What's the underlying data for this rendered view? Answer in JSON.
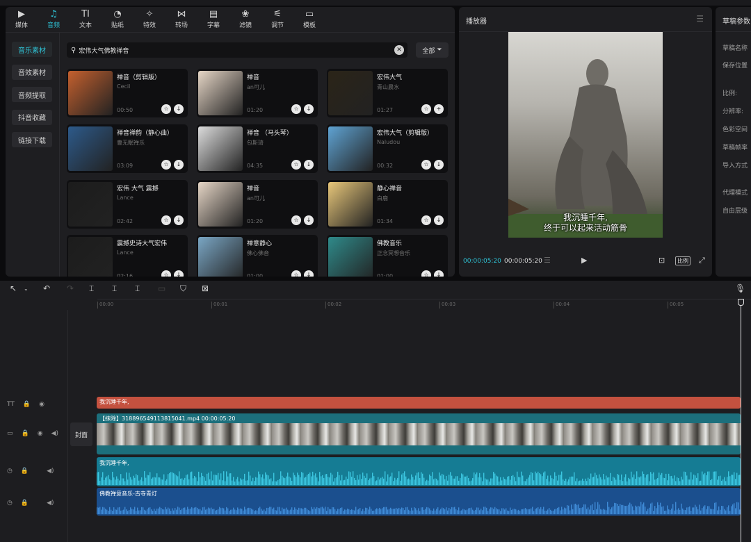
{
  "tabs": [
    {
      "label": "媒体",
      "icon": "media-icon",
      "glyph": "▶"
    },
    {
      "label": "音频",
      "icon": "audio-icon",
      "glyph": "♫",
      "active": true
    },
    {
      "label": "文本",
      "icon": "text-icon",
      "glyph": "TI"
    },
    {
      "label": "贴纸",
      "icon": "sticker-icon",
      "glyph": "◔"
    },
    {
      "label": "特效",
      "icon": "effects-icon",
      "glyph": "✧"
    },
    {
      "label": "转场",
      "icon": "transition-icon",
      "glyph": "⋈"
    },
    {
      "label": "字幕",
      "icon": "caption-icon",
      "glyph": "▤"
    },
    {
      "label": "滤镜",
      "icon": "filter-icon",
      "glyph": "❀"
    },
    {
      "label": "调节",
      "icon": "adjust-icon",
      "glyph": "⚟"
    },
    {
      "label": "模板",
      "icon": "template-icon",
      "glyph": "▭"
    }
  ],
  "subnav": [
    "音乐素材",
    "音效素材",
    "音频提取",
    "抖音收藏",
    "链接下载"
  ],
  "search": {
    "value": "宏伟大气佛教禅音"
  },
  "filter_label": "全部",
  "music": [
    {
      "title": "禅音（剪辑版）",
      "artist": "Cecil",
      "duration": "00:50",
      "thumb": "#c4602e"
    },
    {
      "title": "禅音",
      "artist": "an可儿",
      "duration": "01:20",
      "thumb": "#e6d6c6"
    },
    {
      "title": "宏伟大气",
      "artist": "青山晨水",
      "duration": "01:27",
      "thumb": "#2b2418"
    },
    {
      "title": "禅音禅韵（静心曲）",
      "artist": "曹无眠禅乐",
      "duration": "03:09",
      "thumb": "#2d5a8a"
    },
    {
      "title": "禅音 （马头琴）",
      "artist": "包斯琦",
      "duration": "04:35",
      "thumb": "#dcdcdc"
    },
    {
      "title": "宏伟大气（剪辑版）",
      "artist": "Naludou",
      "duration": "00:32",
      "thumb": "#5fa3d3"
    },
    {
      "title": "宏伟 大气 震撼",
      "artist": "Lance",
      "duration": "02:42",
      "thumb": "#1c1c1c"
    },
    {
      "title": "禅音",
      "artist": "an可儿",
      "duration": "01:20",
      "thumb": "#e6d6c6"
    },
    {
      "title": "静心禅音",
      "artist": "白鹿",
      "duration": "01:34",
      "thumb": "#e8c77a"
    },
    {
      "title": "震撼史诗大气宏伟",
      "artist": "Lance",
      "duration": "02:16",
      "thumb": "#1c1c1c"
    },
    {
      "title": "禅意静心",
      "artist": "佛心佛音",
      "duration": "01:00",
      "thumb": "#7aa6c4"
    },
    {
      "title": "佛教音乐",
      "artist": "正念冥想音乐",
      "duration": "01:00",
      "thumb": "#2f8a8a"
    }
  ],
  "player": {
    "title": "播放器",
    "subtitle_line1": "我沉睡千年,",
    "subtitle_line2": "终于可以起来活动筋骨",
    "time_current": "00:00:05:20",
    "time_total": "00:00:05:20",
    "ratio_label": "比例"
  },
  "params": {
    "title": "草稿参数",
    "rows": [
      "草稿名称",
      "保存位置",
      "比例:",
      "分辨率:",
      "色彩空间",
      "草稿帧率",
      "导入方式",
      "代理模式",
      "自由层级"
    ]
  },
  "ruler": [
    "00:00",
    "00:01",
    "00:02",
    "00:03",
    "00:04",
    "00:05"
  ],
  "timeline": {
    "cover_label": "封面",
    "text_clip": "我沉睡千年,",
    "video_clip": "【抹除】318896549113815041.mp4   00:00:05:20",
    "audio1_clip": "我沉睡千年,",
    "audio2_clip": "佛教禅意音乐-古寺青灯"
  }
}
